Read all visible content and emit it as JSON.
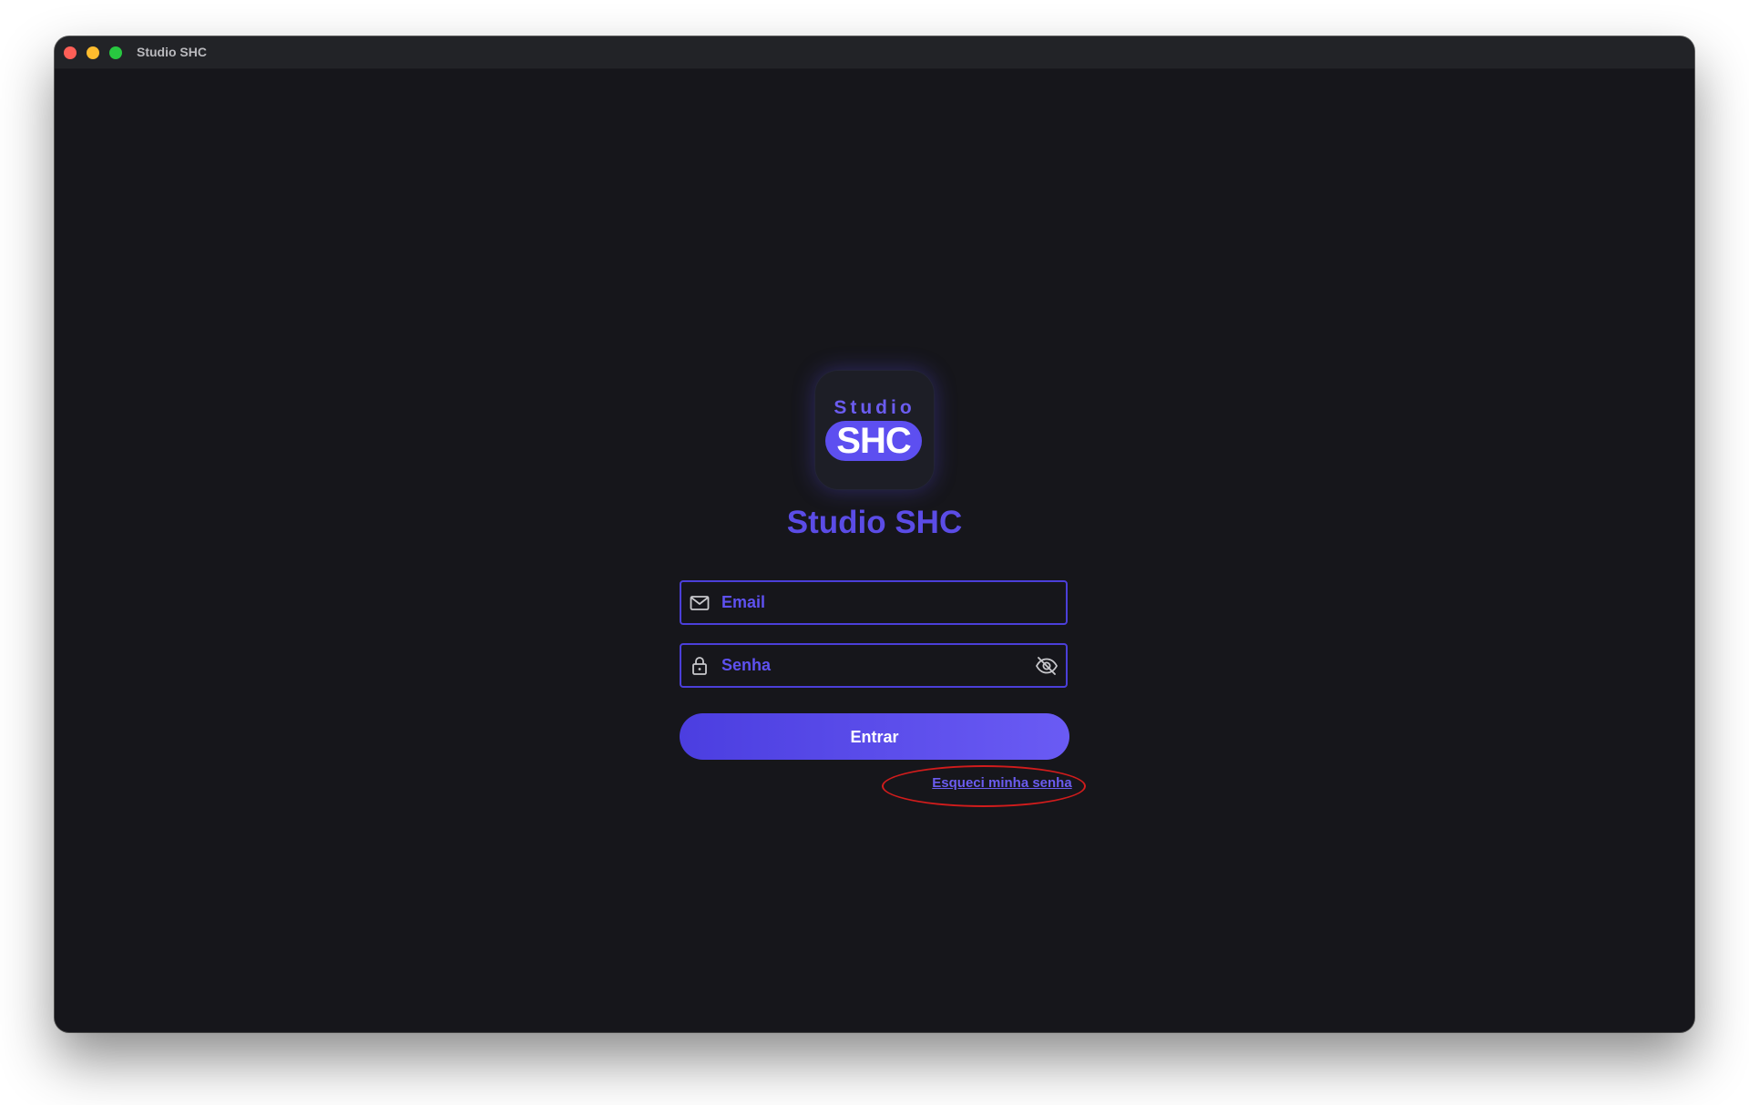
{
  "window": {
    "title": "Studio SHC",
    "controls": [
      "close",
      "minimize",
      "maximize"
    ]
  },
  "logo": {
    "top_text": "Studio",
    "badge_text": "SHC"
  },
  "app_title": "Studio SHC",
  "form": {
    "email": {
      "placeholder": "Email",
      "value": "",
      "icon": "mail-icon"
    },
    "password": {
      "placeholder": "Senha",
      "value": "",
      "icon": "lock-icon",
      "toggle_icon": "eye-off-icon"
    },
    "submit_label": "Entrar",
    "forgot_label": "Esqueci minha senha"
  },
  "colors": {
    "background": "#16161b",
    "accent": "#5b4ce6",
    "annotation": "#d11c1c"
  }
}
